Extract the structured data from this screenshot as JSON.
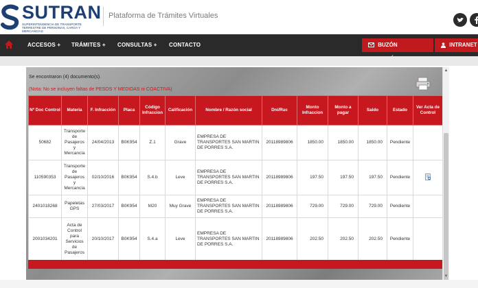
{
  "brand": {
    "name": "SUTRAN",
    "subtitle": "Superintendencia de Transporte Terrestre de Personas, Carga y Mercancías",
    "platform": "Plataforma de Trámites Virtuales",
    "color": "#1d3f72"
  },
  "social": {
    "twitter_icon": "twitter-icon",
    "facebook_icon": "facebook-icon"
  },
  "nav": {
    "items": [
      "ACCESOS +",
      "TRÁMITES +",
      "CONSULTAS +",
      "CONTACTO"
    ],
    "buzon": "BUZÓN ELECTRÓNICO",
    "intranet": "INTRANET",
    "accent": "#c01a1f"
  },
  "results": {
    "found": "Se encontraron (4) documento(s).",
    "note": "(Nota: No se incluyen faltas de PESOS Y MEDIDAS ni COACTIVA)"
  },
  "table": {
    "headers": [
      "Nº Doc Control",
      "Materia",
      "F. Infracción",
      "Placa",
      "Código Infraccion",
      "Calificación",
      "Nombre / Razón social",
      "Dni/Ruc",
      "Monto Infraccion",
      "Monto a pagar",
      "Saldo",
      "Estado",
      "Ver Acta de Control"
    ],
    "rows": [
      [
        "50682",
        "Transporte de Pasajeros y Mercancía",
        "24/04/2013",
        "B0K954",
        "Z.1",
        "Grave",
        "EMPRESA DE TRANSPORTES SAN MARTIN DE PORRES S.A.",
        "20118989806",
        "1850.00",
        "1850.00",
        "1850.00",
        "Pendiente",
        ""
      ],
      [
        "110590353",
        "Transporte de Pasajeros y Mercancía",
        "02/10/2016",
        "B0K954",
        "S.4.b",
        "Leve",
        "EMPRESA DE TRANSPORTES SAN MARTIN DE PORRES S.A.",
        "20118989806",
        "197.50",
        "197.50",
        "197.50",
        "Pendiente",
        "view"
      ],
      [
        "2401018268",
        "Papeletas GPS",
        "27/03/2017",
        "B0K954",
        "M20",
        "Muy Grave",
        "EMPRESA DE TRANSPORTES SAN MARTIN DE PORRES S.A.",
        "20118989806",
        "729.00",
        "729.00",
        "729.00",
        "Pendiente",
        ""
      ],
      [
        "2001034201",
        "Acta de Control para Servicios de Pasajeros",
        "20/10/2017",
        "B0K954",
        "S.4.a",
        "Leve",
        "EMPRESA DE TRANSPORTES SAN MARTIN DE PORRES S.A.",
        "20118989806",
        "202.50",
        "202.50",
        "202.50",
        "Pendiente",
        ""
      ]
    ]
  }
}
